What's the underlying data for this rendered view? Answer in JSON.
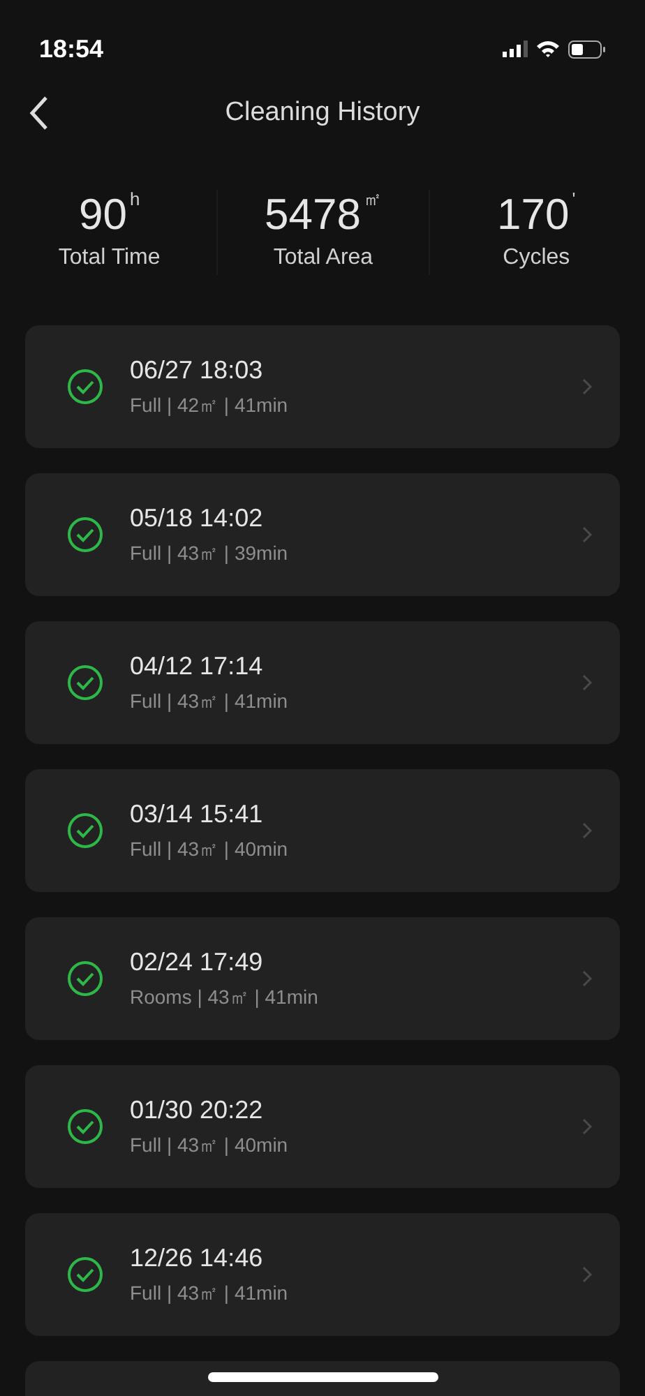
{
  "status_bar": {
    "time": "18:54"
  },
  "header": {
    "title": "Cleaning History"
  },
  "stats": [
    {
      "value": "90",
      "unit": "h",
      "label": "Total Time"
    },
    {
      "value": "5478",
      "unit": "㎡",
      "label": "Total Area"
    },
    {
      "value": "170",
      "unit": "'",
      "label": "Cycles"
    }
  ],
  "records": [
    {
      "datetime": "06/27 18:03",
      "details": "Full | 42㎡ | 41min",
      "completed": true
    },
    {
      "datetime": "05/18 14:02",
      "details": "Full | 43㎡ | 39min",
      "completed": true
    },
    {
      "datetime": "04/12 17:14",
      "details": "Full | 43㎡ | 41min",
      "completed": true
    },
    {
      "datetime": "03/14 15:41",
      "details": "Full | 43㎡ | 40min",
      "completed": true
    },
    {
      "datetime": "02/24 17:49",
      "details": "Rooms | 43㎡ | 41min",
      "completed": true
    },
    {
      "datetime": "01/30 20:22",
      "details": "Full | 43㎡ | 40min",
      "completed": true
    },
    {
      "datetime": "12/26 14:46",
      "details": "Full | 43㎡ | 41min",
      "completed": true
    }
  ]
}
